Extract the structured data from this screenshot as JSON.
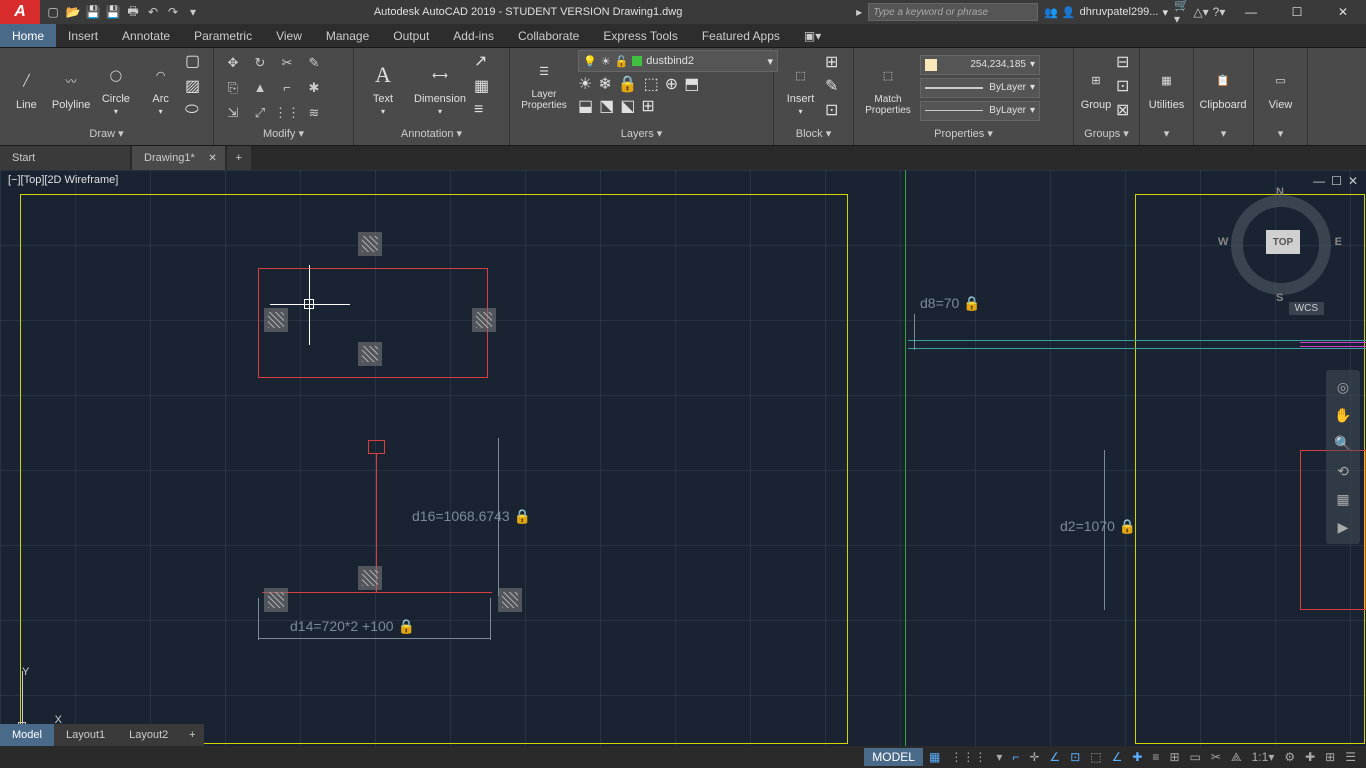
{
  "title": "Autodesk AutoCAD 2019 - STUDENT VERSION   Drawing1.dwg",
  "search_placeholder": "Type a keyword or phrase",
  "user": "dhruvpatel299...",
  "menu_tabs": [
    "Home",
    "Insert",
    "Annotate",
    "Parametric",
    "View",
    "Manage",
    "Output",
    "Add-ins",
    "Collaborate",
    "Express Tools",
    "Featured Apps"
  ],
  "active_menu": 0,
  "ribbon": {
    "draw": {
      "label": "Draw ▾",
      "tools": [
        "Line",
        "Polyline",
        "Circle",
        "Arc"
      ]
    },
    "modify": {
      "label": "Modify ▾"
    },
    "annotation": {
      "label": "Annotation ▾",
      "text": "Text",
      "dimension": "Dimension"
    },
    "layers": {
      "label": "Layers ▾",
      "props": "Layer Properties",
      "current": "dustbind2"
    },
    "block": {
      "label": "Block ▾",
      "insert": "Insert"
    },
    "properties": {
      "label": "Properties ▾",
      "match": "Match Properties",
      "color": "254,234,185",
      "line1": "ByLayer",
      "line2": "ByLayer"
    },
    "groups": {
      "label": "Groups ▾",
      "group": "Group"
    },
    "utilities": {
      "label": "Utilities"
    },
    "clipboard": {
      "label": "Clipboard"
    },
    "view": {
      "label": "View"
    }
  },
  "filetabs": {
    "start": "Start",
    "drawing": "Drawing1*"
  },
  "view_label": "[−][Top][2D Wireframe]",
  "dimensions": {
    "d8": "d8=70",
    "d16": "d16=1068.6743",
    "d14": "d14=720*2  +100",
    "d2": "d2=1070"
  },
  "viewcube": {
    "top": "TOP",
    "n": "N",
    "s": "S",
    "e": "E",
    "w": "W",
    "wcs": "WCS"
  },
  "ucs": {
    "x": "X",
    "y": "Y"
  },
  "bottom_tabs": {
    "model": "Model",
    "layout1": "Layout1",
    "layout2": "Layout2"
  },
  "statusbar": {
    "model": "MODEL",
    "scale": "1:1"
  }
}
